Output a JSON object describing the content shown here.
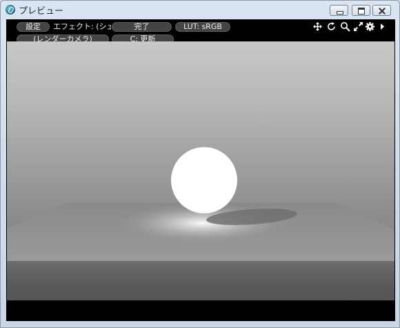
{
  "window": {
    "title": "プレビュー"
  },
  "toolbar": {
    "settings_label": "設定",
    "effect_label": "エフェクト: (シェ...",
    "done_label": "完了",
    "lut_label": "LUT: sRGB",
    "camera_label": "(レンダーカメラ)",
    "refresh_label": "C: 更新"
  },
  "tools": [
    "move-icon",
    "rotate-icon",
    "zoom-icon",
    "maximize-icon",
    "gear-icon",
    "play-icon"
  ]
}
